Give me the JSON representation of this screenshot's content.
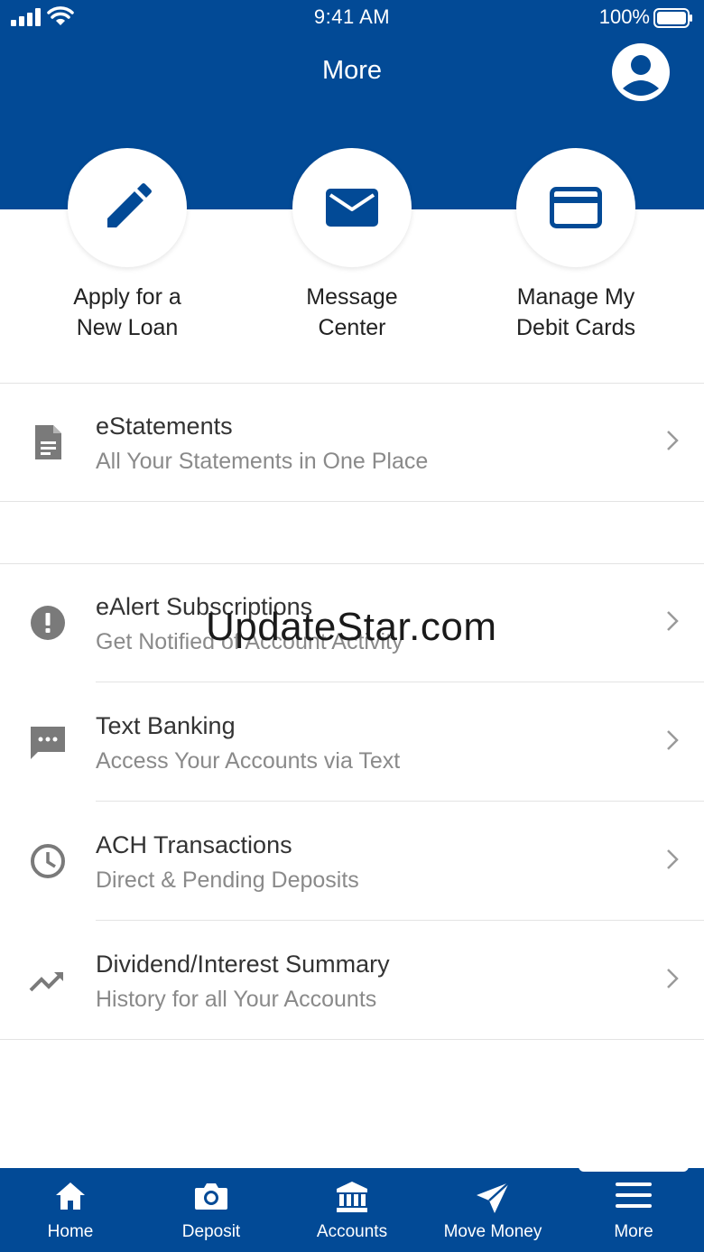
{
  "status_bar": {
    "time": "9:41 AM",
    "battery": "100%"
  },
  "header": {
    "title": "More"
  },
  "quick_actions": [
    {
      "label": "Apply for a\nNew Loan",
      "icon": "pencil-icon"
    },
    {
      "label": "Message\nCenter",
      "icon": "envelope-icon"
    },
    {
      "label": "Manage My\nDebit Cards",
      "icon": "card-icon"
    }
  ],
  "menu": [
    {
      "title": "eStatements",
      "subtitle": "All Your Statements in One Place",
      "icon": "document-icon"
    },
    {
      "title": "eAlert Subscriptions",
      "subtitle": "Get Notified of Account Activity",
      "icon": "alert-icon"
    },
    {
      "title": "Text Banking",
      "subtitle": "Access Your Accounts via Text",
      "icon": "chat-icon"
    },
    {
      "title": "ACH Transactions",
      "subtitle": "Direct & Pending Deposits",
      "icon": "clock-icon"
    },
    {
      "title": "Dividend/Interest Summary",
      "subtitle": "History for all Your Accounts",
      "icon": "trending-up-icon"
    }
  ],
  "watermark": "UpdateStar.com",
  "tabs": [
    {
      "label": "Home",
      "icon": "home-icon"
    },
    {
      "label": "Deposit",
      "icon": "camera-icon"
    },
    {
      "label": "Accounts",
      "icon": "bank-icon"
    },
    {
      "label": "Move Money",
      "icon": "send-icon"
    },
    {
      "label": "More",
      "icon": "menu-icon"
    }
  ],
  "colors": {
    "brand": "#024a96",
    "icon_gray": "#7a7a7a",
    "subtitle_gray": "#8a8a8a"
  }
}
